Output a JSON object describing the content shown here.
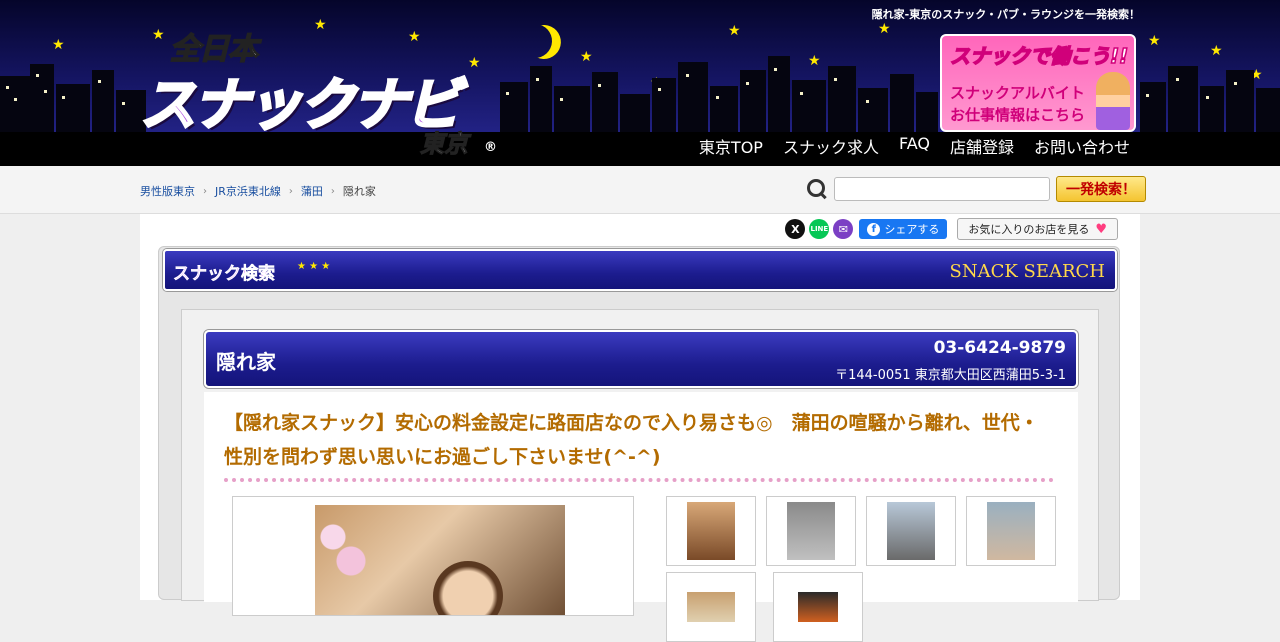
{
  "header": {
    "tagline": "隠れ家-東京のスナック・パブ・ラウンジを一発検索！",
    "logo": {
      "line1": "全日本",
      "line2": "スナックナビ",
      "line3": "東京",
      "registered": "®"
    },
    "banner": {
      "line1": "スナックで働こう!!",
      "line2": "スナックアルバイト",
      "line3": "お仕事情報はこちら"
    },
    "nav": [
      "東京TOP",
      "スナック求人",
      "FAQ",
      "店舗登録",
      "お問い合わせ"
    ]
  },
  "breadcrumb": {
    "items": [
      "男性版東京",
      "JR京浜東北線",
      "蒲田"
    ],
    "current": "隠れ家",
    "separator": "›"
  },
  "search": {
    "placeholder": "",
    "button_label": "一発検索！"
  },
  "share": {
    "x": "X",
    "line": "LINE",
    "mail": "✉",
    "facebook_label": "シェアする",
    "favorites_label": "お気に入りのお店を見る"
  },
  "panel": {
    "title_jp": "スナック検索",
    "title_en": "SNACK SEARCH"
  },
  "shop": {
    "name": "隠れ家",
    "tel": "03-6424-9879",
    "address": "〒144-0051 東京都大田区西蒲田5-3-1",
    "catch": "【隠れ家スナック】安心の料金設定に路面店なので入り易さも◎　蒲田の喧騒から離れ、世代・性別を問わず思い思いにお過ごし下さいませ(^-^)"
  },
  "colors": {
    "header_sky": "#141460",
    "nav_bar": "#000000",
    "panel_blue": "#1c1c8e",
    "catch_text": "#b36b00",
    "search_button": "#f4c430",
    "link": "#1a4fa0"
  },
  "thumbnails": [
    "photo-woman",
    "photo-entrance",
    "photo-interior-sofa",
    "photo-interior-counter",
    "photo-sign",
    "photo-tv"
  ]
}
